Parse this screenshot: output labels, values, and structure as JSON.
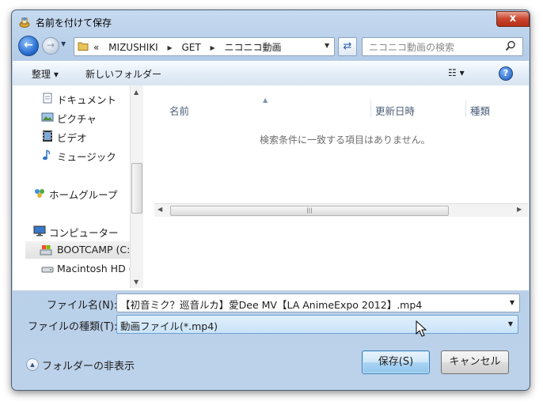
{
  "window": {
    "title": "名前を付けて保存",
    "close_label": "x"
  },
  "address_bar": {
    "prefix": "«",
    "crumbs": [
      "MIZUSHIKI",
      "GET",
      "ニコニコ動画"
    ],
    "search_placeholder": "ニコニコ動画の検索"
  },
  "command_bar": {
    "organize": "整理 ▾",
    "new_folder": "新しいフォルダー",
    "view": "☷ ▾",
    "help": "?"
  },
  "nav_pane": {
    "items": [
      {
        "label": "ドキュメント",
        "icon": "documents-icon"
      },
      {
        "label": "ピクチャ",
        "icon": "pictures-icon"
      },
      {
        "label": "ビデオ",
        "icon": "videos-icon"
      },
      {
        "label": "ミュージック",
        "icon": "music-icon"
      },
      {
        "label": "ホームグループ",
        "icon": "homegroup-icon"
      },
      {
        "label": "コンピューター",
        "icon": "computer-icon"
      },
      {
        "label": "BOOTCAMP (C:",
        "icon": "drive-icon"
      },
      {
        "label": "Macintosh HD (",
        "icon": "hard-disk-icon"
      }
    ]
  },
  "file_list": {
    "columns": [
      "名前",
      "更新日時",
      "種類"
    ],
    "empty_message": "検索条件に一致する項目はありません。"
  },
  "form": {
    "filename_label": "ファイル名(N):",
    "filename_value": "【初音ミク？巡音ルカ】愛Dee MV【LA AnimeExpo 2012】.mp4",
    "filetype_label": "ファイルの種類(T):",
    "filetype_value": "動画ファイル(*.mp4)"
  },
  "footer": {
    "hide_folders": "フォルダーの非表示",
    "save": "保存(S)",
    "cancel": "キャンセル"
  }
}
